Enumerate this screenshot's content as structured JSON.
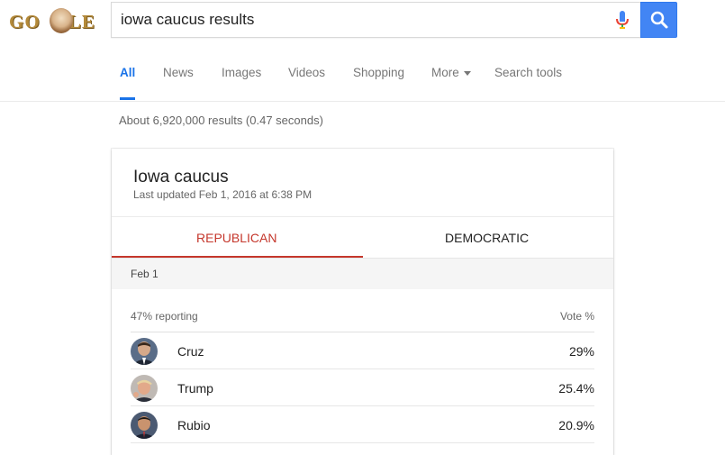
{
  "search": {
    "query": "iowa caucus results"
  },
  "nav": {
    "tabs": [
      {
        "label": "All"
      },
      {
        "label": "News"
      },
      {
        "label": "Images"
      },
      {
        "label": "Videos"
      },
      {
        "label": "Shopping"
      },
      {
        "label": "More"
      },
      {
        "label": "Search tools"
      }
    ]
  },
  "stats": "About 6,920,000 results (0.47 seconds)",
  "card": {
    "title": "Iowa caucus",
    "updated": "Last updated Feb 1, 2016 at 6:38 PM",
    "party_tabs": [
      "REPUBLICAN",
      "DEMOCRATIC"
    ],
    "date": "Feb 1",
    "reporting": "47% reporting",
    "vote_header": "Vote %",
    "candidates": [
      {
        "name": "Cruz",
        "vote": "29%"
      },
      {
        "name": "Trump",
        "vote": "25.4%"
      },
      {
        "name": "Rubio",
        "vote": "20.9%"
      }
    ]
  },
  "colors": {
    "accent_blue": "#1a73e8",
    "search_button": "#4285f4",
    "republican_red": "#c5372c"
  }
}
